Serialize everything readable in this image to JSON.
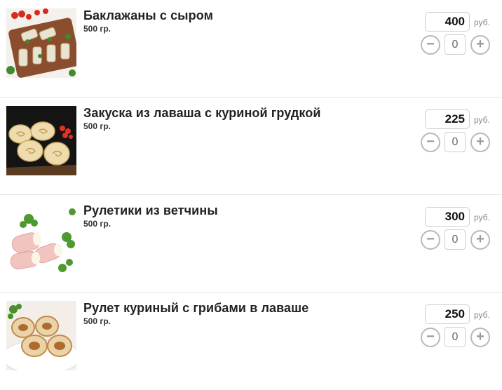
{
  "products": [
    {
      "title": "Баклажаны с сыром",
      "weight": "500 гр.",
      "price": "400",
      "currency": "руб.",
      "quantity": "0",
      "minus_label": "−",
      "plus_label": "+",
      "image_icon": "eggplant-rolls-image"
    },
    {
      "title": "Закуска из лаваша с куриной грудкой",
      "weight": "500 гр.",
      "price": "225",
      "currency": "руб.",
      "quantity": "0",
      "minus_label": "−",
      "plus_label": "+",
      "image_icon": "lavash-rolls-image"
    },
    {
      "title": "Рулетики из ветчины",
      "weight": "500 гр.",
      "price": "300",
      "currency": "руб.",
      "quantity": "0",
      "minus_label": "−",
      "plus_label": "+",
      "image_icon": "ham-rolls-image"
    },
    {
      "title": "Рулет куриный с грибами в лаваше",
      "weight": "500 гр.",
      "price": "250",
      "currency": "руб.",
      "quantity": "0",
      "minus_label": "−",
      "plus_label": "+",
      "image_icon": "chicken-mushroom-roll-image"
    }
  ]
}
